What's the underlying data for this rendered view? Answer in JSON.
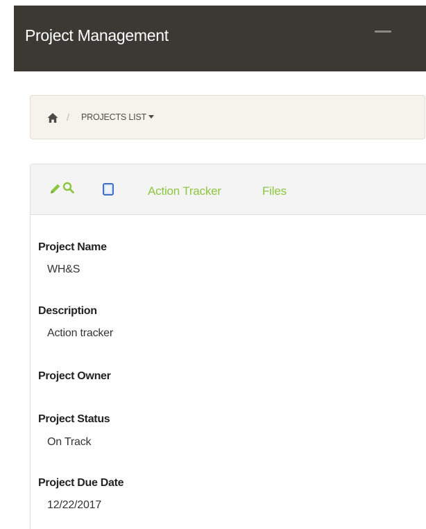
{
  "header": {
    "app_title": "Project Management"
  },
  "breadcrumb": {
    "home_icon": "home-icon",
    "separator": "/",
    "projects_label": "PROJECTS LIST"
  },
  "toolbar": {
    "icons": [
      "pencil-icon",
      "search-icon",
      "document-icon"
    ],
    "tabs": [
      {
        "label": "Action Tracker"
      },
      {
        "label": "Files"
      }
    ]
  },
  "project": {
    "fields": [
      {
        "label": "Project Name",
        "value": "WH&S"
      },
      {
        "label": "Description",
        "value": "Action tracker"
      },
      {
        "label": "Project Owner",
        "value": ""
      },
      {
        "label": "Project Status",
        "value": "On Track"
      },
      {
        "label": "Project Due Date",
        "value": "12/22/2017"
      }
    ]
  },
  "colors": {
    "header_bg": "#3a3934",
    "accent_green": "#8cc63f",
    "breadcrumb_bg": "#f6f3ec",
    "doc_icon_blue": "#3d6fc4"
  }
}
